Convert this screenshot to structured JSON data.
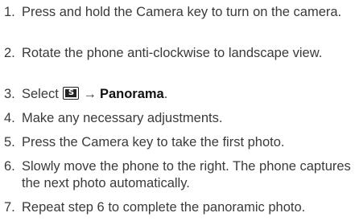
{
  "steps": [
    {
      "number": "1.",
      "text": "Press and hold the Camera key to turn on the camera."
    },
    {
      "number": "2.",
      "text": "Rotate the phone anti-clockwise to landscape view."
    },
    {
      "number": "3.",
      "prefix": "Select",
      "key_icon_label": "S",
      "arrow": "→",
      "bold_text": "Panorama",
      "suffix": "."
    },
    {
      "number": "4.",
      "text": "Make any necessary adjustments."
    },
    {
      "number": "5.",
      "text": "Press the Camera key to take the first photo."
    },
    {
      "number": "6.",
      "text": "Slowly move the phone to the right. The phone captures the next photo automatically."
    },
    {
      "number": "7.",
      "text": "Repeat step 6 to complete the panoramic photo."
    }
  ]
}
